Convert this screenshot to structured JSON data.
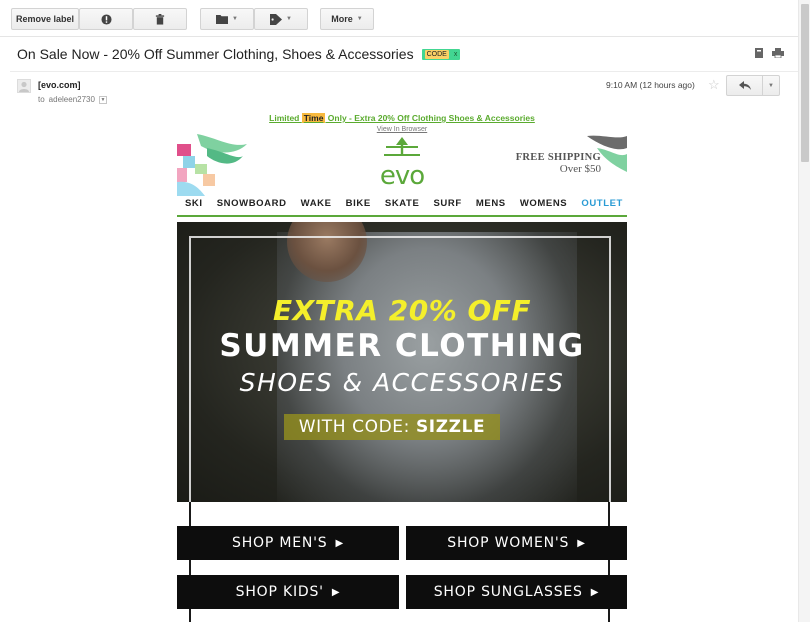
{
  "toolbar": {
    "remove_label": "Remove label",
    "more_label": "More"
  },
  "message": {
    "subject": "On Sale Now - 20% Off Summer Clothing, Shoes & Accessories",
    "label_name": "CODE",
    "label_remove": "x",
    "label_colors": {
      "chip": "#42d692",
      "name_bg": "#fad165"
    },
    "sender": "[evo.com]",
    "to_prefix": "to",
    "to_user": "adeleen2730",
    "time": "9:10 AM (12 hours ago)"
  },
  "email": {
    "preheader_before": "Limited ",
    "preheader_highlight": "Time",
    "preheader_after": " Only - Extra 20% Off Clothing Shoes & Accessories",
    "view_in_browser": "View In Browser",
    "logo": "evo",
    "free_shipping": "FREE SHIPPING",
    "free_shipping_over": "Over $50",
    "nav": [
      "SKI",
      "SNOWBOARD",
      "WAKE",
      "BIKE",
      "SKATE",
      "SURF",
      "MENS",
      "WOMENS",
      "OUTLET"
    ],
    "hero": {
      "line1": "EXTRA 20% OFF",
      "line2": "SUMMER CLOTHING",
      "line3": "SHOES & ACCESSORIES",
      "code_prefix": "WITH CODE: ",
      "code": "SIZZLE"
    },
    "buttons": {
      "mens": "SHOP MEN'S",
      "womens": "SHOP WOMEN'S",
      "kids": "SHOP KIDS'",
      "sunglasses": "SHOP SUNGLASSES"
    },
    "colors": {
      "brand_green": "#5ba83a",
      "outlet_blue": "#2a9bd4",
      "headline_yellow": "#f4ef2b"
    }
  }
}
